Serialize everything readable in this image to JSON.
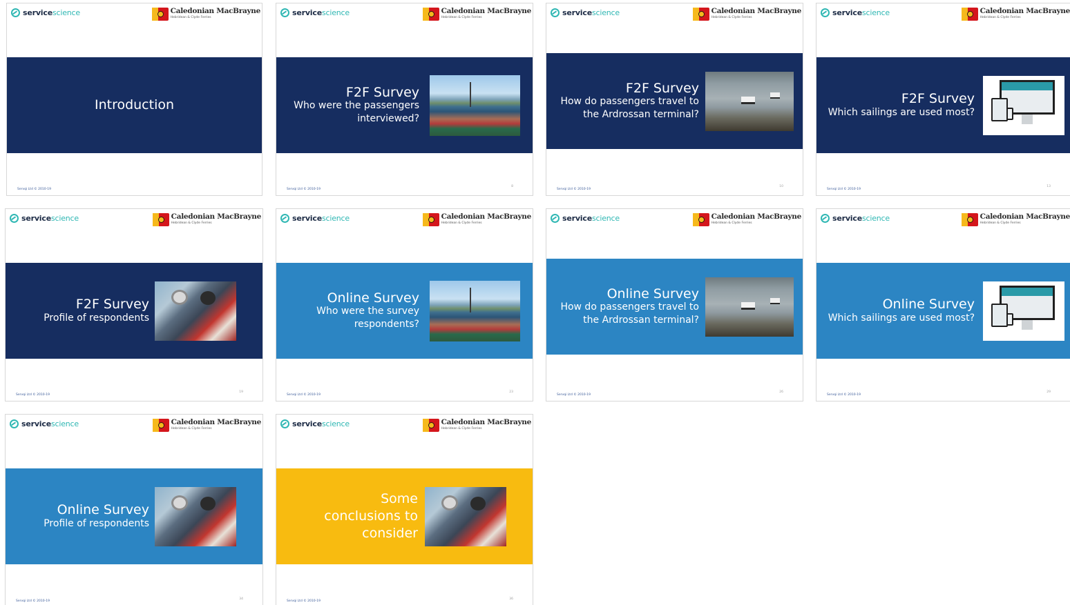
{
  "logos": {
    "service_bold": "service",
    "service_light": "science",
    "cm_name": "Caledonian MacBrayne",
    "cm_sub": "Hebridean & Clyde Ferries"
  },
  "footer_text": "Servqi Ltd © 2010-19",
  "colors": {
    "navy": "#162d60",
    "blue": "#2c85c3",
    "yellow": "#f8bb10",
    "teal": "#2fb7b3"
  },
  "slides": [
    {
      "title": "Introduction",
      "subtitle": "",
      "page": "",
      "image": "none",
      "theme": "navy"
    },
    {
      "title": "F2F Survey",
      "subtitle": "Who were the passengers interviewed?",
      "page": "8",
      "image": "ferry-deck-photo",
      "theme": "navy"
    },
    {
      "title": "F2F Survey",
      "subtitle": "How do passengers travel to the Ardrossan terminal?",
      "page": "10",
      "image": "ferry-sea-photo",
      "theme": "navy"
    },
    {
      "title": "F2F Survey",
      "subtitle": "Which sailings are used most?",
      "page": "13",
      "image": "devices-website-image",
      "theme": "navy"
    },
    {
      "title": "F2F Survey",
      "subtitle": "Profile of respondents",
      "page": "19",
      "image": "passengers-photo",
      "theme": "navy"
    },
    {
      "title": "Online Survey",
      "subtitle": "Who were the survey respondents?",
      "page": "23",
      "image": "ferry-deck-photo",
      "theme": "blue"
    },
    {
      "title": "Online Survey",
      "subtitle": "How do passengers travel to the Ardrossan terminal?",
      "page": "26",
      "image": "ferry-sea-photo",
      "theme": "blue"
    },
    {
      "title": "Online Survey",
      "subtitle": "Which sailings are used most?",
      "page": "29",
      "image": "devices-website-image",
      "theme": "blue"
    },
    {
      "title": "Online Survey",
      "subtitle": "Profile of respondents",
      "page": "34",
      "image": "passengers-photo",
      "theme": "blue"
    },
    {
      "title": "Some conclusions to consider",
      "subtitle": "",
      "page": "36",
      "image": "passengers-photo",
      "theme": "yellow"
    }
  ]
}
